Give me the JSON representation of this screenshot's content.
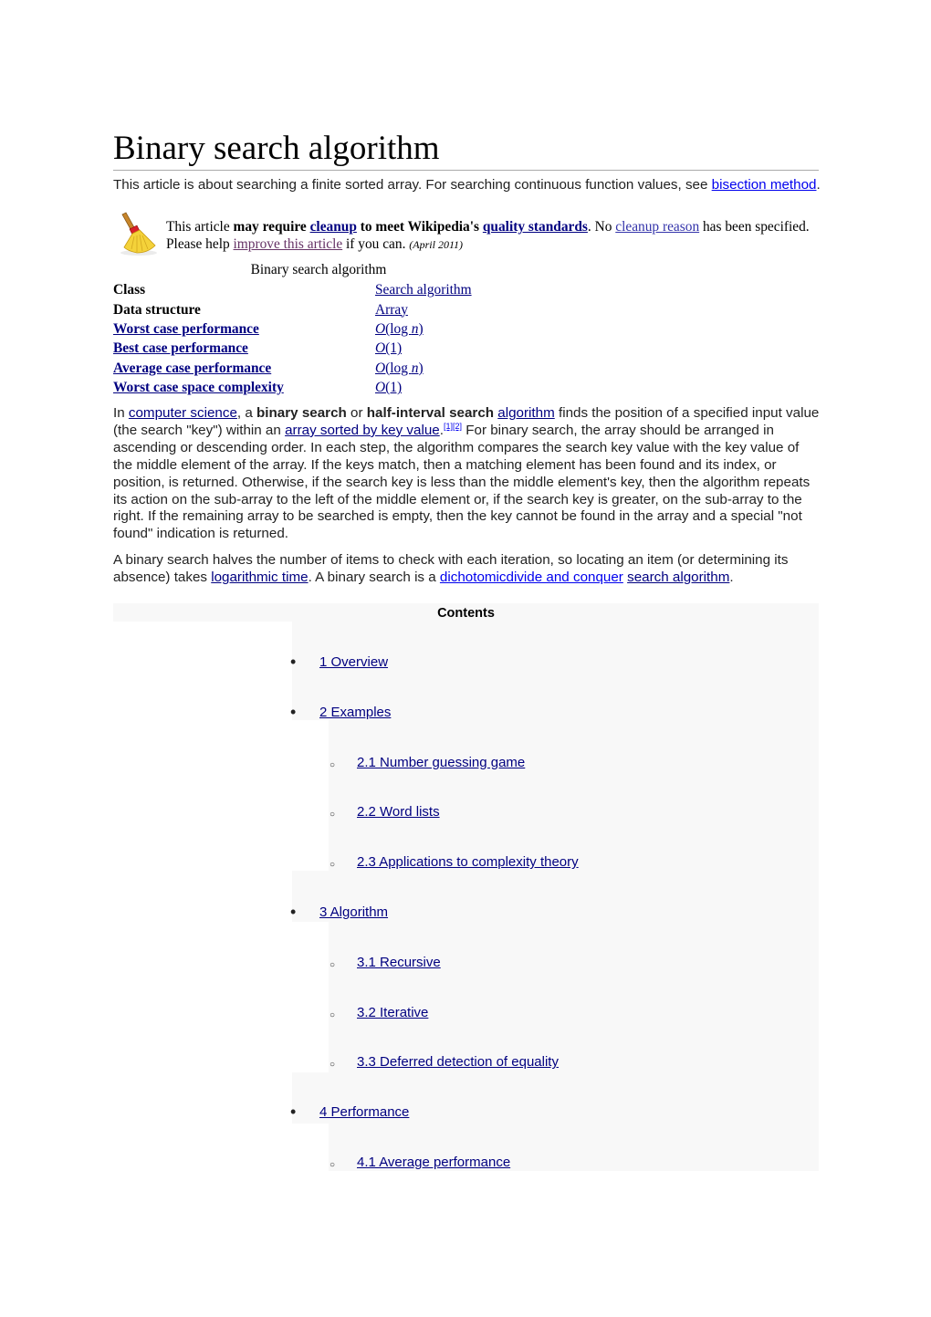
{
  "article": {
    "title": "Binary search algorithm",
    "hatnote": {
      "text_before": "This article is about searching a finite sorted array. For searching continuous function values, see ",
      "link": "bisection method",
      "text_after": "."
    },
    "cleanup_notice": {
      "icon": "broom-icon",
      "t1": "This article ",
      "b1": "may require ",
      "link_cleanup": "cleanup",
      "b2": " to meet Wikipedia's ",
      "link_quality": "quality standards",
      "t2": ". No ",
      "link_reason": "cleanup reason",
      "t3": " has been specified. Please help ",
      "link_improve": "improve this article",
      "t4": " if you can. ",
      "date": "(April 2011)"
    },
    "infobox": {
      "caption": "Binary search algorithm",
      "rows": [
        {
          "label": "Class",
          "label_link": false,
          "value": "Search algorithm"
        },
        {
          "label": "Data structure",
          "label_link": false,
          "value": "Array"
        },
        {
          "label": "Worst case performance",
          "label_link": true,
          "value_o": "O",
          "value_rest": "(log ",
          "value_n": "n",
          "value_close": ")"
        },
        {
          "label": "Best case performance",
          "label_link": true,
          "value_o": "O",
          "value_rest": "(1)",
          "value_n": "",
          "value_close": ""
        },
        {
          "label": "Average case performance",
          "label_link": true,
          "value_o": "O",
          "value_rest": "(log ",
          "value_n": "n",
          "value_close": ")"
        },
        {
          "label": "Worst case space complexity",
          "label_link": true,
          "value_o": "O",
          "value_rest": "(1)",
          "value_n": "",
          "value_close": ""
        }
      ]
    },
    "paragraph1": {
      "s1": "In ",
      "link_cs": "computer science",
      "s2": ", a ",
      "b_binary": "binary search",
      "s3": " or ",
      "b_half": "half-interval search",
      "s4": " ",
      "link_algorithm": "algorithm",
      "s5": " finds the position of a specified input value (the search \"key\") within an ",
      "link_array": "array sorted by key value",
      "s6": ".",
      "ref1": "[1]",
      "ref2": "[2]",
      "s7": " For binary search, the array should be arranged in ascending or descending order. In each step, the algorithm compares the search key value with the key value of the middle element of the array. If the keys match, then a matching element has been found and its index, or position, is returned. Otherwise, if the search key is less than the middle element's key, then the algorithm repeats its action on the sub-array to the left of the middle element or, if the search key is greater, on the sub-array to the right. If the remaining array to be searched is empty, then the key cannot be found in the array and a special \"not found\" indication is returned."
    },
    "paragraph2": {
      "s1": "A binary search halves the number of items to check with each iteration, so locating an item (or determining its absence) takes ",
      "link_log": "logarithmic time",
      "s2": ". A binary search is a ",
      "link_dc": "dichotomicdivide and conquer",
      "s3": " ",
      "link_sa": "search algorithm",
      "s4": "."
    },
    "toc": {
      "title": "Contents",
      "items": [
        {
          "level": 1,
          "label": "1 Overview"
        },
        {
          "level": 1,
          "label": "2 Examples"
        },
        {
          "level": 2,
          "label": "2.1 Number guessing game"
        },
        {
          "level": 2,
          "label": "2.2 Word lists"
        },
        {
          "level": 2,
          "label": "2.3 Applications to complexity theory"
        },
        {
          "level": 1,
          "label": "3 Algorithm"
        },
        {
          "level": 2,
          "label": "3.1 Recursive"
        },
        {
          "level": 2,
          "label": "3.2 Iterative"
        },
        {
          "level": 2,
          "label": "3.3 Deferred detection of equality"
        },
        {
          "level": 1,
          "label": "4 Performance"
        },
        {
          "level": 2,
          "label": "4.1 Average performance"
        }
      ]
    }
  },
  "colors": {
    "link": "#000080",
    "link_bright": "#0000ee",
    "link_visited": "#663366",
    "toc_background": "#f8f8f8",
    "rule": "#aaaaaa"
  }
}
